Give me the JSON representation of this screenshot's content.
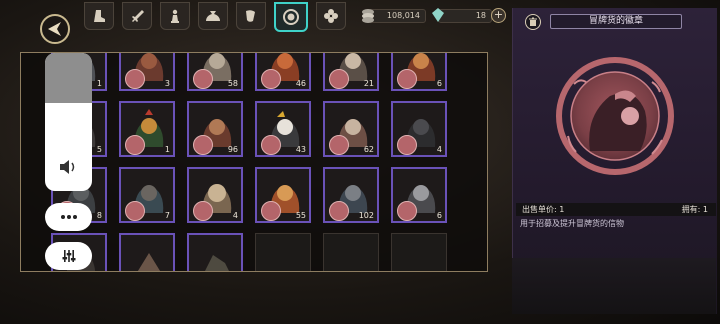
{
  "header": {
    "tabs": [
      {
        "icon": "boot-icon"
      },
      {
        "icon": "sword-icon"
      },
      {
        "icon": "chess-piece-icon"
      },
      {
        "icon": "money-bag-icon"
      },
      {
        "icon": "scroll-icon"
      },
      {
        "icon": "badge-icon",
        "active": true
      },
      {
        "icon": "clover-icon"
      }
    ],
    "currencies": [
      {
        "icon": "coin-stack-icon",
        "value": "108,014"
      },
      {
        "icon": "gem-icon",
        "value": "18"
      }
    ]
  },
  "grid": {
    "cards": [
      {
        "count": "1"
      },
      {
        "count": "3"
      },
      {
        "count": "58"
      },
      {
        "count": "46"
      },
      {
        "count": "21"
      },
      {
        "count": "6"
      },
      {
        "count": "5"
      },
      {
        "count": "1"
      },
      {
        "count": "96"
      },
      {
        "count": "43"
      },
      {
        "count": "62"
      },
      {
        "count": "4"
      },
      {
        "count": "8"
      },
      {
        "count": "7"
      },
      {
        "count": "4"
      },
      {
        "count": "55"
      },
      {
        "count": "102"
      },
      {
        "count": "6"
      },
      {
        "count": ""
      },
      {
        "count": ""
      },
      {
        "count": ""
      }
    ],
    "empty_slots": 3
  },
  "detail": {
    "title": "冒牌货的徽章",
    "price_label": "出售单价: 1",
    "owned_label": "拥有: 1",
    "description": "用于招募及提升冒牌货的信物"
  },
  "colors": {
    "card_border": "#6a52b8",
    "accent_teal": "#3fd3c9",
    "emblem": "#b7676d"
  }
}
